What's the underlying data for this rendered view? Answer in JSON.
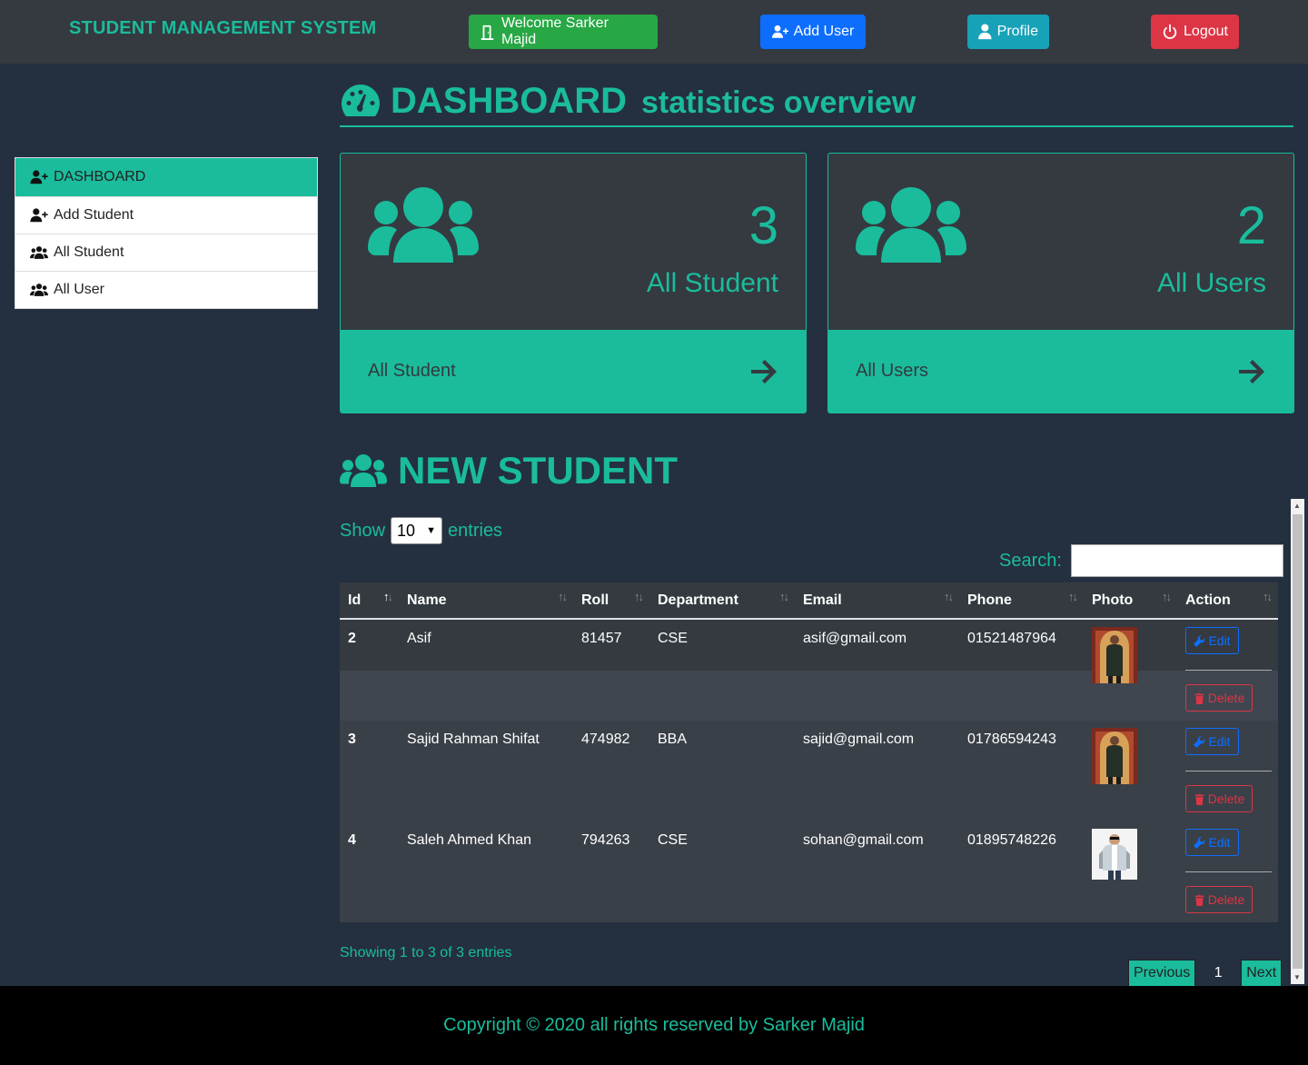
{
  "nav": {
    "brand": "STUDENT MANAGEMENT SYSTEM",
    "welcome": "Welcome Sarker Majid",
    "add_user": "Add User",
    "profile": "Profile",
    "logout": "Logout"
  },
  "sidebar": {
    "items": [
      {
        "label": "DASHBOARD",
        "icon": "user-plus-icon",
        "active": true
      },
      {
        "label": "Add Student",
        "icon": "user-plus-icon"
      },
      {
        "label": "All Student",
        "icon": "users-icon"
      },
      {
        "label": "All User",
        "icon": "users-icon"
      }
    ]
  },
  "heading": {
    "main": "DASHBOARD",
    "sub": "statistics overview"
  },
  "cards": [
    {
      "count": "3",
      "label": "All Student",
      "footer": "All Student"
    },
    {
      "count": "2",
      "label": "All Users",
      "footer": "All Users"
    }
  ],
  "new_student": {
    "title": "NEW STUDENT",
    "show_label": "Show",
    "entries_value": "10",
    "entries_label": "entries",
    "search_label": "Search:",
    "columns": [
      "Id",
      "Name",
      "Roll",
      "Department",
      "Email",
      "Phone",
      "Photo",
      "Action"
    ],
    "rows": [
      {
        "id": "2",
        "name": "Asif",
        "roll": "81457",
        "dept": "CSE",
        "email": "asif@gmail.com",
        "phone": "01521487964"
      },
      {
        "id": "3",
        "name": "Sajid Rahman Shifat",
        "roll": "474982",
        "dept": "BBA",
        "email": "sajid@gmail.com",
        "phone": "01786594243"
      },
      {
        "id": "4",
        "name": "Saleh Ahmed Khan",
        "roll": "794263",
        "dept": "CSE",
        "email": "sohan@gmail.com",
        "phone": "01895748226"
      }
    ],
    "edit_label": "Edit",
    "delete_label": "Delete",
    "info": "Showing 1 to 3 of 3 entries",
    "prev": "Previous",
    "page": "1",
    "next": "Next"
  },
  "footer": "Copyright © 2020 all rights reserved by Sarker Majid",
  "colors": {
    "accent": "#1abc9c",
    "bg": "#24303f",
    "nav": "#343a40"
  }
}
